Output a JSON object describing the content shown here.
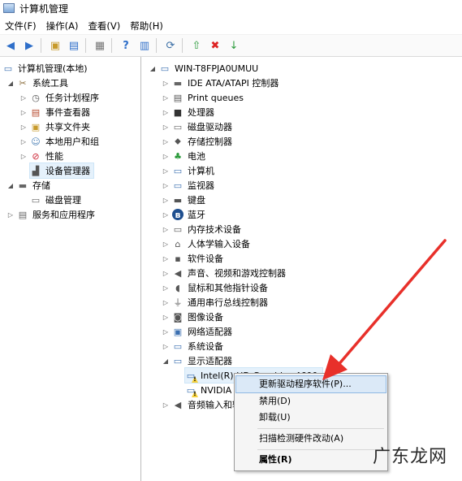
{
  "window": {
    "title": "计算机管理"
  },
  "menu": [
    "文件(F)",
    "操作(A)",
    "查看(V)",
    "帮助(H)"
  ],
  "left_tree": {
    "root": "计算机管理(本地)",
    "system_tools": "系统工具",
    "system_children": [
      "任务计划程序",
      "事件查看器",
      "共享文件夹",
      "本地用户和组",
      "性能",
      "设备管理器"
    ],
    "storage": "存储",
    "storage_children": [
      "磁盘管理"
    ],
    "services": "服务和应用程序"
  },
  "right_tree": {
    "computer": "WIN-T8FPJA0UMUU",
    "categories": [
      "IDE ATA/ATAPI 控制器",
      "Print queues",
      "处理器",
      "磁盘驱动器",
      "存储控制器",
      "电池",
      "计算机",
      "监视器",
      "键盘",
      "蓝牙",
      "内存技术设备",
      "人体学输入设备",
      "软件设备",
      "声音、视频和游戏控制器",
      "鼠标和其他指针设备",
      "通用串行总线控制器",
      "图像设备",
      "网络适配器",
      "系统设备",
      "显示适配器"
    ],
    "display_children": [
      "Intel(R) HD Graphics 4600",
      "NVIDIA"
    ],
    "after": "音频输入和输出"
  },
  "context_menu": {
    "update_driver": "更新驱动程序软件(P)...",
    "disable": "禁用(D)",
    "uninstall": "卸载(U)",
    "scan": "扫描检测硬件改动(A)",
    "properties": "属性(R)"
  },
  "watermark": "广东龙网",
  "colors": {
    "selection": "#e5f1fb",
    "highlight": "#dbe9f7",
    "arrow": "#e8302a"
  }
}
